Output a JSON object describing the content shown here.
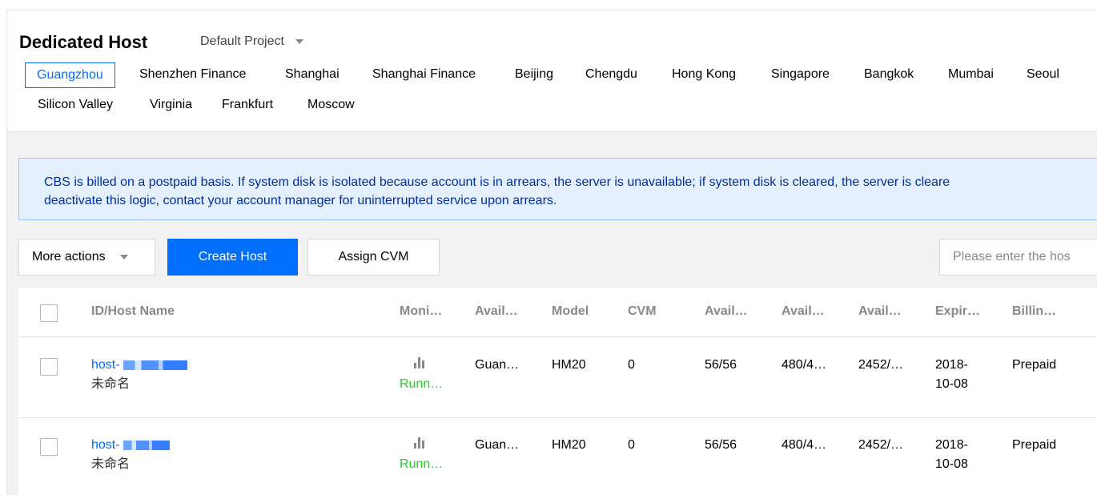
{
  "header": {
    "title": "Dedicated Host",
    "project": "Default Project"
  },
  "regions": [
    {
      "label": "Guangzhou",
      "active": true
    },
    {
      "label": "Shenzhen Finance"
    },
    {
      "label": "Shanghai"
    },
    {
      "label": "Shanghai Finance"
    },
    {
      "label": "Beijing"
    },
    {
      "label": "Chengdu"
    },
    {
      "label": "Hong Kong"
    },
    {
      "label": "Singapore"
    },
    {
      "label": "Bangkok"
    },
    {
      "label": "Mumbai"
    },
    {
      "label": "Seoul"
    },
    {
      "label": "Silicon Valley"
    },
    {
      "label": "Virginia"
    },
    {
      "label": "Frankfurt"
    },
    {
      "label": "Moscow"
    }
  ],
  "notice": {
    "line1": "CBS is billed on a postpaid basis. If system disk is isolated because account is in arrears, the server is unavailable; if system disk is cleared, the server is cleare",
    "line2": "deactivate this logic, contact your account manager for uninterrupted service upon arrears."
  },
  "toolbar": {
    "more_actions": "More actions",
    "create_host": "Create Host",
    "assign_cvm": "Assign CVM",
    "search_placeholder": "Please enter the hos"
  },
  "table": {
    "columns": [
      "ID/Host Name",
      "Moni…",
      "Avail…",
      "Model",
      "CVM",
      "Avail…",
      "Avail…",
      "Avail…",
      "Expir…",
      "Billin…"
    ],
    "rows": [
      {
        "id": "host-",
        "name": "未命名",
        "status": "Runn…",
        "zone": "Guan…",
        "model": "HM20",
        "cvm": "0",
        "vcpu": "56/56",
        "memory": "480/4…",
        "storage": "2452/…",
        "expiry_line1": "2018-",
        "expiry_line2": "10-08",
        "billing": "Prepaid"
      },
      {
        "id": "host-",
        "name": "未命名",
        "status": "Runn…",
        "zone": "Guan…",
        "model": "HM20",
        "cvm": "0",
        "vcpu": "56/56",
        "memory": "480/4…",
        "storage": "2452/…",
        "expiry_line1": "2018-",
        "expiry_line2": "10-08",
        "billing": "Prepaid"
      }
    ]
  },
  "colors": {
    "accent": "#006eff",
    "running": "#29cc2b",
    "notice_bg": "#e5f0ff",
    "notice_text": "#002da0"
  },
  "icons": {
    "project_dropdown": "caret-down-icon",
    "more_actions_dropdown": "caret-down-icon",
    "monitoring": "bar-chart-icon"
  }
}
